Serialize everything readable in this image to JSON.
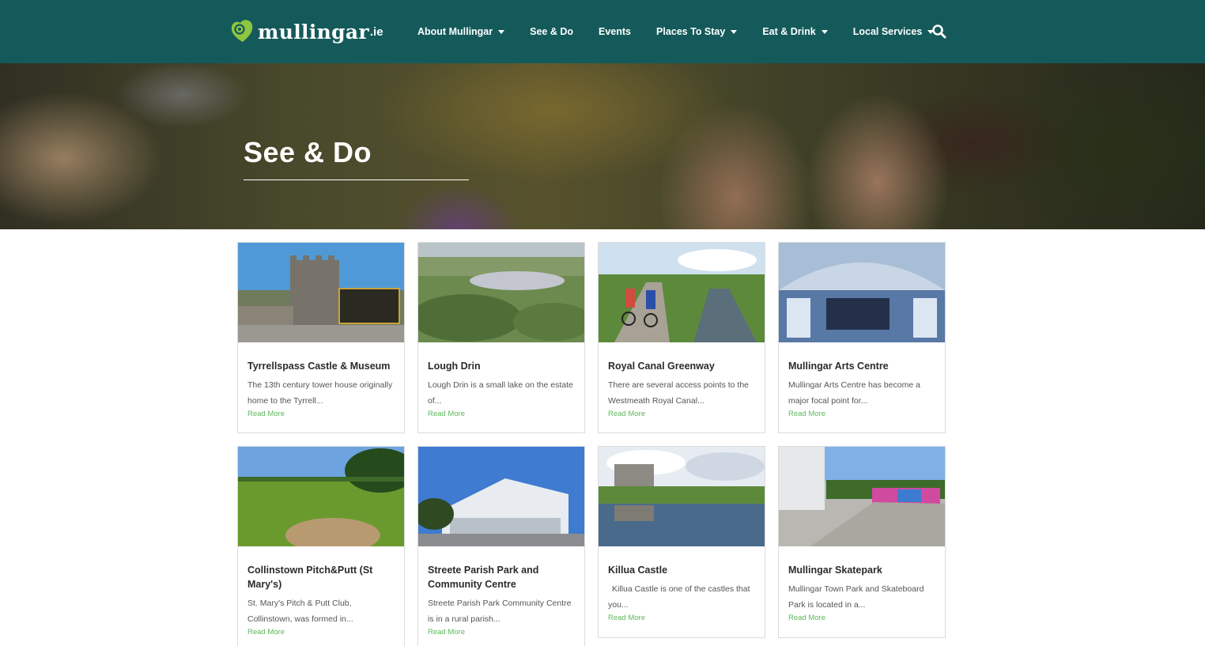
{
  "site": {
    "logo_text": "mullingar",
    "logo_tld": ".ie"
  },
  "nav": {
    "items": [
      {
        "label": "About Mullingar",
        "dropdown": true
      },
      {
        "label": "See & Do",
        "dropdown": false
      },
      {
        "label": "Events",
        "dropdown": false
      },
      {
        "label": "Places To Stay",
        "dropdown": true
      },
      {
        "label": "Eat & Drink",
        "dropdown": true
      },
      {
        "label": "Local Services",
        "dropdown": true
      }
    ],
    "search_icon": "search-icon"
  },
  "hero": {
    "title": "See & Do"
  },
  "cards": [
    {
      "title": "Tyrrellspass Castle & Museum",
      "desc": "The 13th century tower house originally home to the Tyrrell...",
      "more": "Read More"
    },
    {
      "title": "Lough Drin",
      "desc": "Lough Drin is a small lake on the estate of...",
      "more": "Read More"
    },
    {
      "title": "Royal Canal Greenway",
      "desc": "There are several access points to the Westmeath Royal Canal...",
      "more": "Read More"
    },
    {
      "title": "Mullingar Arts Centre",
      "desc": "Mullingar Arts Centre has become a major focal point for...",
      "more": "Read More"
    },
    {
      "title": "Collinstown Pitch&Putt (St Mary's)",
      "desc": "St. Mary's Pitch & Putt Club, Collinstown, was formed in...",
      "more": "Read More"
    },
    {
      "title": "Streete Parish Park and Community Centre",
      "desc": "Streete Parish Park Community Centre is in a rural parish...",
      "more": "Read More"
    },
    {
      "title": "Killua Castle",
      "desc": "Killua Castle is one of the castles that you...",
      "more": "Read More"
    },
    {
      "title": "Mullingar Skatepark",
      "desc": "Mullingar Town Park and Skateboard Park is located in a...",
      "more": "Read More"
    }
  ],
  "colors": {
    "header_bg": "#155a5a",
    "logo_green": "#8dc63f",
    "read_more": "#5cb85c"
  }
}
